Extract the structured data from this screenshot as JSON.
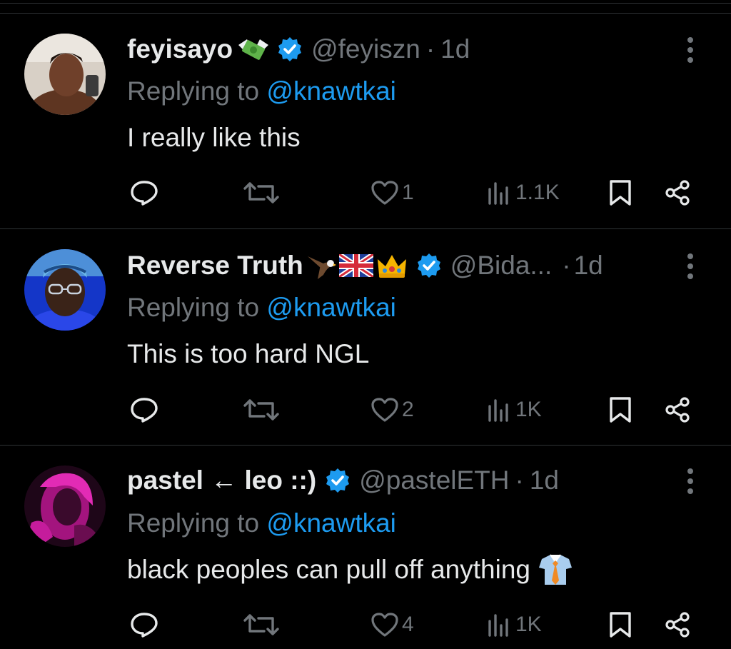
{
  "tweets": [
    {
      "name": "feyisayo",
      "name_emojis": [
        "money-with-wings"
      ],
      "handle": "@feyiszn",
      "dot": "·",
      "time": "1d",
      "replying_prefix": "Replying to ",
      "replying_to": "@knawtkai",
      "text": "I really like this",
      "text_emoji": "",
      "likes": "1",
      "views": "1.1K",
      "avatar_colors": [
        "#d9d2c8",
        "#6b3e26"
      ]
    },
    {
      "name": "Reverse Truth",
      "name_emojis": [
        "eagle",
        "uk-flag",
        "crown"
      ],
      "handle": "@Bida...",
      "dot": "·",
      "time": "1d",
      "replying_prefix": "Replying to ",
      "replying_to": "@knawtkai",
      "text": "This is too hard NGL",
      "text_emoji": "",
      "likes": "2",
      "views": "1K",
      "avatar_colors": [
        "#1a3dd6",
        "#3a2318"
      ]
    },
    {
      "name": "pastel ← leo ::)",
      "name_emojis": [],
      "handle": "@pastelETH",
      "dot": "·",
      "time": "1d",
      "replying_prefix": "Replying to ",
      "replying_to": "@knawtkai",
      "text": "black peoples can pull off anything",
      "text_emoji": "shirt-and-tie",
      "likes": "4",
      "views": "1K",
      "avatar_colors": [
        "#c81c9c",
        "#2a0820"
      ]
    }
  ],
  "colors": {
    "background": "#000000",
    "text": "#e7e9ea",
    "muted": "#71767b",
    "link": "#1d9bf0",
    "verified": "#1d9bf0",
    "divider": "#2f3336"
  },
  "icons": {
    "reply": "reply-icon",
    "retweet": "retweet-icon",
    "like": "heart-icon",
    "views": "views-icon",
    "bookmark": "bookmark-icon",
    "share": "share-icon",
    "more": "more-icon",
    "verified": "verified-badge-icon"
  }
}
